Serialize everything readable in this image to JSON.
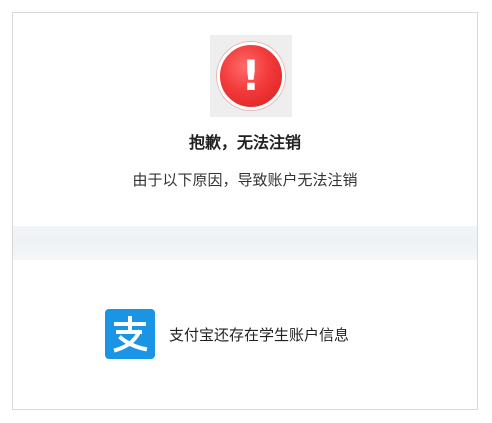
{
  "dialog": {
    "alert_icon_glyph": "!",
    "title": "抱歉，无法注销",
    "subtitle": "由于以下原因，导致账户无法注销"
  },
  "reasons": [
    {
      "icon": "alipay-logo",
      "text": "支付宝还存在学生账户信息"
    }
  ],
  "colors": {
    "alert_red": "#ef3434",
    "alipay_blue": "#1a95e6",
    "icon_tile": "#eeeeee",
    "divider": "#eef2f5"
  }
}
